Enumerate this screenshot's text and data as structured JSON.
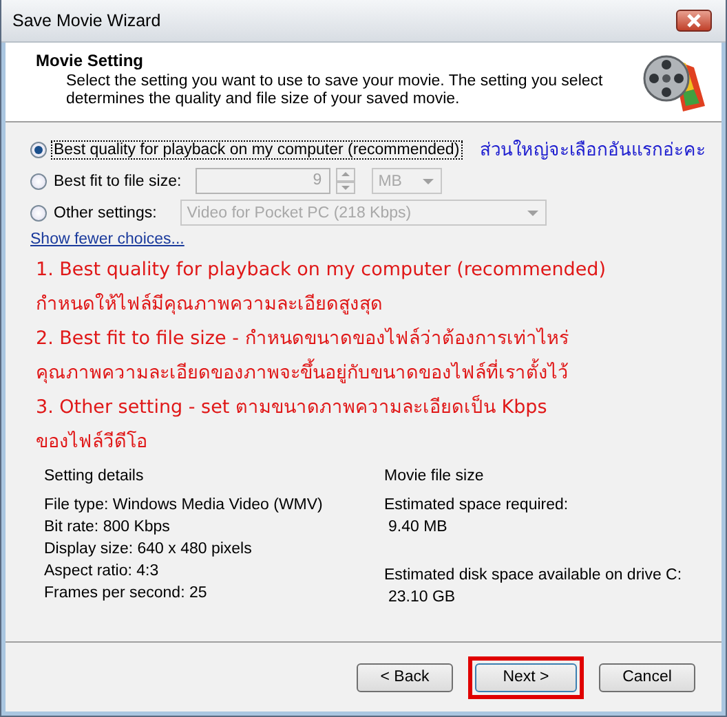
{
  "window": {
    "title": "Save Movie Wizard"
  },
  "header": {
    "title": "Movie Setting",
    "description": "Select the setting you want to use to save your movie. The setting you select determines the quality and file size of your saved movie."
  },
  "options": [
    {
      "kind": "plain",
      "label": "Best quality for playback on my computer (recommended)",
      "selected": true,
      "note": "ส่วนใหญ่จะเลือกอันแรกอ่ะคะ"
    },
    {
      "kind": "spin",
      "label": "Best fit to file size:",
      "selected": false,
      "value": "9",
      "unit": "MB",
      "disabled": true
    },
    {
      "kind": "dropdown",
      "label": "Other settings:",
      "selected": false,
      "value": "Video for Pocket PC (218 Kbps)",
      "disabled": true
    }
  ],
  "link": "Show fewer choices...",
  "annotations": [
    "1. Best quality for playback on my computer (recommended)",
    "กำหนดให้ไฟล์มีคุณภาพความละเอียดสูงสุด",
    "2. Best fit to file size - กำหนดขนาดของไฟล์ว่าต้องการเท่าไหร่",
    "คุณภาพความละเอียดของภาพจะขึ้นอยู่กับขนาดของไฟล์ที่เราตั้งไว้",
    "3. Other setting - set ตามขนาดภาพความละเอียดเป็น Kbps",
    "ของไฟล์วีดีโอ"
  ],
  "details": {
    "heading": "Setting details",
    "lines": [
      "File type: Windows Media Video (WMV)",
      "Bit rate: 800 Kbps",
      "Display size: 640 x 480 pixels",
      "Aspect ratio: 4:3",
      "Frames per second: 25"
    ]
  },
  "file_size": {
    "heading": "Movie file size",
    "items": [
      {
        "label": "Estimated space required:",
        "value": "9.40 MB"
      },
      {
        "label": "Estimated disk space available on drive C:",
        "value": "23.10 GB"
      }
    ]
  },
  "buttons": [
    {
      "label": "< Back",
      "highlighted": false
    },
    {
      "label": "Next >",
      "highlighted": true
    },
    {
      "label": "Cancel",
      "highlighted": false
    }
  ]
}
